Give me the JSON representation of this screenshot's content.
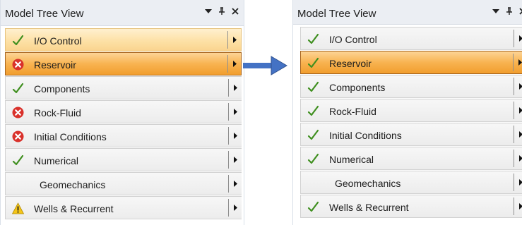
{
  "left_panel": {
    "title": "Model Tree View",
    "items": [
      {
        "label": "I/O Control",
        "status": "check",
        "state": "highlight"
      },
      {
        "label": "Reservoir",
        "status": "error",
        "state": "selected"
      },
      {
        "label": "Components",
        "status": "check",
        "state": "normal"
      },
      {
        "label": "Rock-Fluid",
        "status": "error",
        "state": "normal"
      },
      {
        "label": "Initial Conditions",
        "status": "error",
        "state": "normal"
      },
      {
        "label": "Numerical",
        "status": "check",
        "state": "normal"
      },
      {
        "label": "Geomechanics",
        "status": "none",
        "state": "normal"
      },
      {
        "label": "Wells & Recurrent",
        "status": "warning",
        "state": "normal"
      }
    ]
  },
  "right_panel": {
    "title": "Model Tree View",
    "items": [
      {
        "label": "I/O Control",
        "status": "check",
        "state": "normal"
      },
      {
        "label": "Reservoir",
        "status": "check",
        "state": "selected"
      },
      {
        "label": "Components",
        "status": "check",
        "state": "normal"
      },
      {
        "label": "Rock-Fluid",
        "status": "check",
        "state": "normal"
      },
      {
        "label": "Initial Conditions",
        "status": "check",
        "state": "normal"
      },
      {
        "label": "Numerical",
        "status": "check",
        "state": "normal"
      },
      {
        "label": "Geomechanics",
        "status": "none",
        "state": "normal"
      },
      {
        "label": "Wells & Recurrent",
        "status": "check",
        "state": "normal"
      }
    ]
  },
  "icons": {
    "check": "checkmark-icon",
    "error": "error-x-icon",
    "warning": "warning-triangle-icon",
    "expand": "chevron-right-icon",
    "dropdown": "dropdown-triangle-icon",
    "pin": "pin-icon",
    "close": "close-icon",
    "transition": "right-arrow-icon"
  },
  "colors": {
    "selected_item": "#f8b351",
    "highlight_item": "#fde1a6",
    "check": "#3f8f1f",
    "error": "#d9312b",
    "warning": "#f5c518",
    "arrow": "#4472c4"
  }
}
